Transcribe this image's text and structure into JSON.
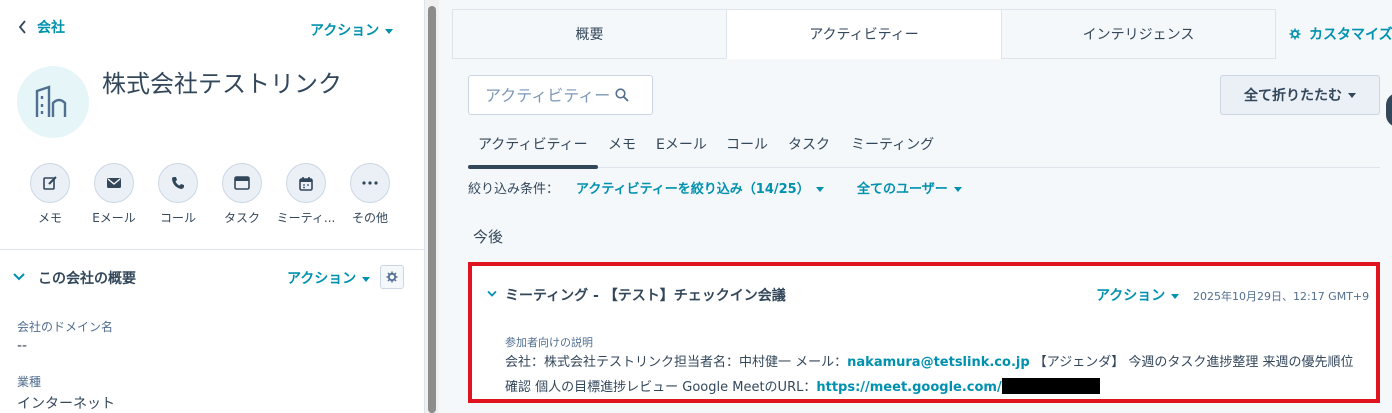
{
  "header": {
    "back_label": "会社",
    "actions_label": "アクション"
  },
  "company": {
    "name": "株式会社テストリンク"
  },
  "quick_actions": [
    {
      "label": "メモ",
      "icon": "edit-icon"
    },
    {
      "label": "Eメール",
      "icon": "email-icon"
    },
    {
      "label": "コール",
      "icon": "phone-icon"
    },
    {
      "label": "タスク",
      "icon": "task-icon"
    },
    {
      "label": "ミーティ...",
      "icon": "calendar-icon"
    },
    {
      "label": "その他",
      "icon": "more-icon"
    }
  ],
  "overview": {
    "title": "この会社の概要",
    "actions_label": "アクション",
    "properties": [
      {
        "label": "会社のドメイン名",
        "value": "--"
      },
      {
        "label": "業種",
        "value": "インターネット"
      }
    ]
  },
  "tabs": [
    {
      "label": "概要",
      "active": false
    },
    {
      "label": "アクティビティー",
      "active": true
    },
    {
      "label": "インテリジェンス",
      "active": false
    }
  ],
  "customize_label": "カスタマイズ",
  "search": {
    "placeholder": "アクティビティー"
  },
  "collapse_all_label": "全て折りたたむ",
  "subtabs": [
    {
      "label": "アクティビティー",
      "active": true
    },
    {
      "label": "メモ",
      "active": false
    },
    {
      "label": "Eメール",
      "active": false
    },
    {
      "label": "コール",
      "active": false
    },
    {
      "label": "タスク",
      "active": false
    },
    {
      "label": "ミーティング",
      "active": false
    }
  ],
  "filters": {
    "label": "絞り込み条件：",
    "activities": "アクティビティーを絞り込み（14/25）",
    "users": "全てのユーザー"
  },
  "section_upcoming": "今後",
  "meeting": {
    "title": "ミーティング - 【テスト】チェックイン会議",
    "actions_label": "アクション",
    "datetime": "2025年10月29日、12:17 GMT+9",
    "description_label": "参加者向けの説明",
    "description_part1": "会社：株式会社テストリンク担当者名：中村健一 メール：",
    "email": "nakamura@tetslink.co.jp",
    "description_part2": " 【アジェンダ】 今週のタスク進捗整理 来週の優先順位確認 個人の目標進捗レビュー Google MeetのURL：",
    "url": "https://meet.google.com/"
  },
  "colors": {
    "accent": "#0091ae",
    "text": "#33475b",
    "highlight_border": "#e0141e"
  }
}
